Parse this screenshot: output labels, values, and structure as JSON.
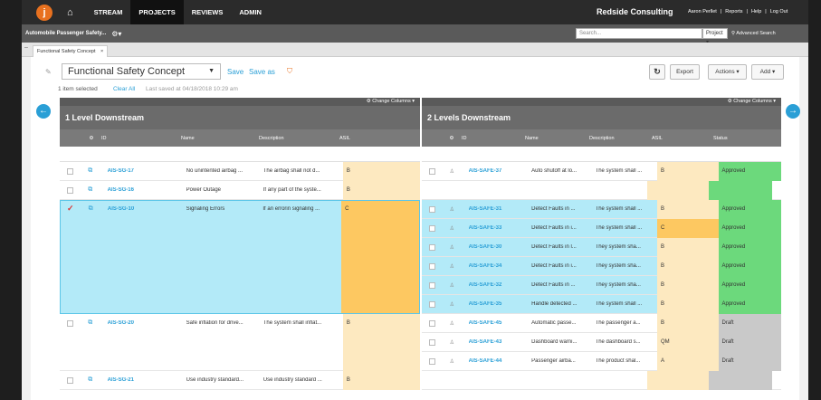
{
  "nav": {
    "logo": "j",
    "home_icon": "home-icon",
    "items": [
      "STREAM",
      "PROJECTS",
      "REVIEWS",
      "ADMIN"
    ],
    "active": "PROJECTS",
    "company": "Redside Consulting",
    "user": "Aaron Perllet",
    "reports": "Reports",
    "help": "Help",
    "logout": "Log Out"
  },
  "project": {
    "name": "Automobile Passenger Safety...",
    "search_placeholder": "Search...",
    "scope": "Project",
    "advanced": "Advanced Search"
  },
  "tab": {
    "label": "Functional Safety Concept",
    "close": "×"
  },
  "toolbar": {
    "view_name": "Functional Safety Concept",
    "save": "Save",
    "save_as": "Save as",
    "selected": "1 item selected",
    "clear_all": "Clear All",
    "last_saved": "Last saved at 04/18/2018 10:29 am",
    "refresh_icon": "refresh-icon",
    "export": "Export",
    "actions": "Actions",
    "add": "Add"
  },
  "colors": {
    "accent": "#2a9fd6",
    "brand": "#e8711f",
    "approved": "#6cd97c",
    "draft": "#c9c9c9",
    "selected": "#b3eaf8",
    "asil": "#fde9c0",
    "asil_sel": "#fdc861"
  },
  "left": {
    "change_columns": "Change Columns",
    "title": "1 Level Downstream",
    "columns": [
      "ID",
      "Name",
      "Description",
      "ASIL"
    ],
    "rows": [
      {
        "id": "AIS-SG-17",
        "name": "No unintented airbag ...",
        "desc": "The airbag shall not d...",
        "asil": "B"
      },
      {
        "id": "AIS-SG-16",
        "name": "Power Outage",
        "desc": "If any part of the syste...",
        "asil": "B"
      },
      {
        "id": "AIS-SG-10",
        "name": "Signaling Errors",
        "desc": "If an errorin signaling ...",
        "asil": "C"
      },
      {
        "id": "AIS-SG-20",
        "name": "Safe inflation for drive...",
        "desc": "The system shall inflat...",
        "asil": "B"
      },
      {
        "id": "AIS-SG-21",
        "name": "Use industry standard...",
        "desc": "Use industry standard ...",
        "asil": "B"
      }
    ]
  },
  "right": {
    "change_columns": "Change Columns",
    "title": "2 Levels Downstream",
    "columns": [
      "ID",
      "Name",
      "Description",
      "ASIL",
      "Status"
    ],
    "rows": [
      {
        "id": "AIS-SAFE-37",
        "name": "Auto shutoff at lo...",
        "desc": "The system shall ...",
        "asil": "B",
        "status": "Approved"
      },
      {
        "id": "AIS-SAFE-31",
        "name": "Detect Faults in ...",
        "desc": "The system shall ...",
        "asil": "B",
        "status": "Approved"
      },
      {
        "id": "AIS-SAFE-33",
        "name": "Detect Faults in i...",
        "desc": "The system shall ...",
        "asil": "C",
        "status": "Approved"
      },
      {
        "id": "AIS-SAFE-30",
        "name": "Detect Faults in l...",
        "desc": "They system sha...",
        "asil": "B",
        "status": "Approved"
      },
      {
        "id": "AIS-SAFE-34",
        "name": "Detect Faults in i...",
        "desc": "They system sha...",
        "asil": "B",
        "status": "Approved"
      },
      {
        "id": "AIS-SAFE-32",
        "name": "Detect Faults in ...",
        "desc": "They system sha...",
        "asil": "B",
        "status": "Approved"
      },
      {
        "id": "AIS-SAFE-35",
        "name": "Handle detected ...",
        "desc": "The system shall ...",
        "asil": "B",
        "status": "Approved"
      },
      {
        "id": "AIS-SAFE-45",
        "name": "Automatic passe...",
        "desc": "The passenger a...",
        "asil": "B",
        "status": "Draft"
      },
      {
        "id": "AIS-SAFE-43",
        "name": "Dashboard warni...",
        "desc": "The dashboard s...",
        "asil": "QM",
        "status": "Draft"
      },
      {
        "id": "AIS-SAFE-44",
        "name": "Passenger airba...",
        "desc": "The product shal...",
        "asil": "A",
        "status": "Draft"
      }
    ]
  }
}
